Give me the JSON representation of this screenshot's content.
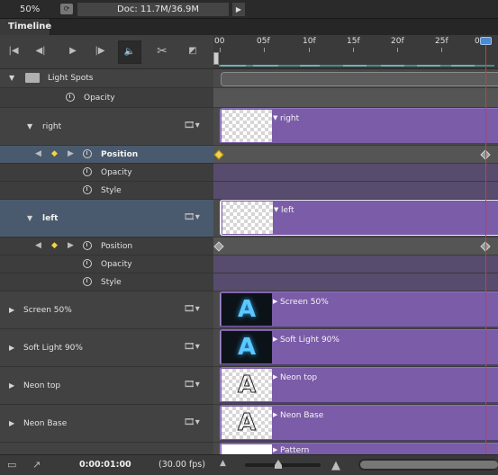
{
  "statusbar": {
    "zoom": "50%",
    "doc": "Doc: 11.7M/36.9M"
  },
  "panel": {
    "tab": "Timeline"
  },
  "controls": {
    "icons": [
      "first-frame-icon",
      "previous-frame-icon",
      "play-icon",
      "next-frame-icon",
      "audio-icon",
      "scissors-icon",
      "transition-icon"
    ]
  },
  "ruler": {
    "labels": [
      "00",
      "05f",
      "10f",
      "15f",
      "20f",
      "25f",
      "0"
    ]
  },
  "layers": [
    {
      "id": "light-spots",
      "label": "Light Spots",
      "kind": "group"
    },
    {
      "id": "light-spots-opacity",
      "label": "Opacity",
      "kind": "property"
    },
    {
      "id": "right",
      "label": "right",
      "kind": "layer",
      "clip": "right"
    },
    {
      "id": "right-position",
      "label": "Position",
      "kind": "property"
    },
    {
      "id": "right-opacity",
      "label": "Opacity",
      "kind": "property"
    },
    {
      "id": "right-style",
      "label": "Style",
      "kind": "property"
    },
    {
      "id": "left",
      "label": "left",
      "kind": "layer",
      "clip": "left"
    },
    {
      "id": "left-position",
      "label": "Position",
      "kind": "property"
    },
    {
      "id": "left-opacity",
      "label": "Opacity",
      "kind": "property"
    },
    {
      "id": "left-style",
      "label": "Style",
      "kind": "property"
    },
    {
      "id": "screen",
      "label": "Screen 50%",
      "kind": "layer",
      "clip": "Screen 50%"
    },
    {
      "id": "softlight",
      "label": "Soft Light 90%",
      "kind": "layer",
      "clip": "Soft Light 90%"
    },
    {
      "id": "neontop",
      "label": "Neon top",
      "kind": "layer",
      "clip": "Neon top"
    },
    {
      "id": "neonbase",
      "label": "Neon Base",
      "kind": "layer",
      "clip": "Neon Base"
    },
    {
      "id": "pattern",
      "label": "",
      "kind": "layer",
      "clip": "Pattern"
    }
  ],
  "bottombar": {
    "time": "0:00:01:00",
    "fps": "(30.00 fps)"
  },
  "colors": {
    "clip": "#7b5ca8",
    "playhead": "#d23a3a",
    "keyframe": "#f1d34a",
    "selection": "#4a5a6e"
  }
}
